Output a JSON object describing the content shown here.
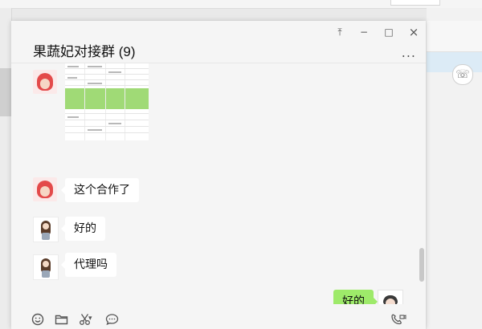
{
  "window": {
    "title": "果蔬妃对接群 (9)",
    "controls": {
      "pin": "⤒",
      "minimize": "−",
      "maximize": "□",
      "close": "×"
    },
    "more": "..."
  },
  "messages": [
    {
      "side": "left",
      "avatar": "red-hat-avatar",
      "type": "image",
      "image": "spreadsheet-screenshot-thumbnail"
    },
    {
      "side": "left",
      "avatar": "red-hat-avatar",
      "type": "text",
      "text": "这个合作了"
    },
    {
      "side": "left",
      "avatar": "girl-avatar",
      "type": "text",
      "text": "好的"
    },
    {
      "side": "left",
      "avatar": "girl-avatar",
      "type": "text",
      "text": "代理吗"
    },
    {
      "side": "right",
      "avatar": "self-avatar",
      "type": "text",
      "text": "好的"
    }
  ],
  "toolbar": {
    "icons": [
      "emoji-icon",
      "folder-icon",
      "scissors-icon",
      "chat-bubble-icon",
      "video-call-icon"
    ],
    "scissors_dropdown": "▾"
  },
  "colors": {
    "sent_bubble": "#9eea6a",
    "received_bubble": "#ffffff",
    "window_bg": "#f5f5f5"
  }
}
